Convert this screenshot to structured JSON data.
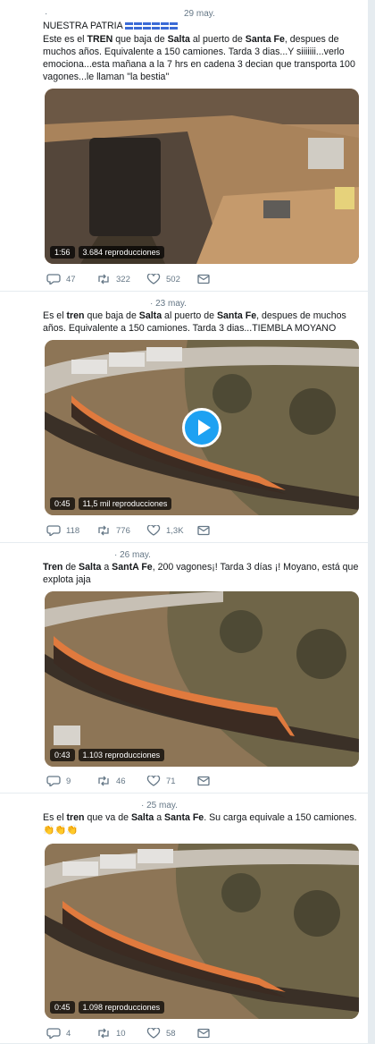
{
  "colors": {
    "accent": "#1da1f2",
    "muted": "#657786",
    "separator": "#e6ecf0"
  },
  "tweets": [
    {
      "dot": "·",
      "date": "29 may.",
      "name": "NUESTRA PATRIA",
      "flag_icon": "flag-honduras-icon",
      "text": [
        {
          "t": "Este es el "
        },
        {
          "t": "TREN",
          "b": true
        },
        {
          "t": " que baja de "
        },
        {
          "t": "Salta",
          "b": true
        },
        {
          "t": " al puerto de "
        },
        {
          "t": "Santa Fe",
          "b": true
        },
        {
          "t": ", despues de muchos años. Equivalente a 150 camiones. Tarda 3 dias...Y siiiiiii...verlo emociona...esta mañana a la 7 hrs en cadena 3 decian que transporta 100 vagones...le llaman \"la bestia\""
        }
      ],
      "duration": "1:56",
      "views": "3.684 reproducciones",
      "replies": "47",
      "retweets": "322",
      "likes": "502"
    },
    {
      "dot": "·",
      "date": "23 may.",
      "text": [
        {
          "t": "Es el "
        },
        {
          "t": "tren",
          "b": true
        },
        {
          "t": " que baja de "
        },
        {
          "t": "Salta",
          "b": true
        },
        {
          "t": " al puerto de "
        },
        {
          "t": "Santa Fe",
          "b": true
        },
        {
          "t": ", despues de muchos años. Equivalente a 150 camiones. Tarda 3 dias...TIEMBLA MOYANO"
        }
      ],
      "duration": "0:45",
      "views": "11,5 mil reproducciones",
      "replies": "118",
      "retweets": "776",
      "likes": "1,3K"
    },
    {
      "dot": "·",
      "date": "26 may.",
      "text": [
        {
          "t": "Tren",
          "b": true
        },
        {
          "t": " de "
        },
        {
          "t": "Salta",
          "b": true
        },
        {
          "t": " a "
        },
        {
          "t": "SantA Fe",
          "b": true
        },
        {
          "t": ", 200 vagones¡! Tarda 3 días ¡! Moyano, está que  explota jaja"
        }
      ],
      "duration": "0:43",
      "views": "1.103 reproducciones",
      "replies": "9",
      "retweets": "46",
      "likes": "71"
    },
    {
      "dot": "·",
      "date": "25 may.",
      "text": [
        {
          "t": "Es el "
        },
        {
          "t": "tren",
          "b": true
        },
        {
          "t": " que va de "
        },
        {
          "t": "Salta",
          "b": true
        },
        {
          "t": " a "
        },
        {
          "t": "Santa Fe",
          "b": true
        },
        {
          "t": ". Su carga equivale a 150 camiones. 👏👏👏"
        }
      ],
      "duration": "0:45",
      "views": "1.098 reproducciones",
      "replies": "4",
      "retweets": "10",
      "likes": "58"
    }
  ]
}
